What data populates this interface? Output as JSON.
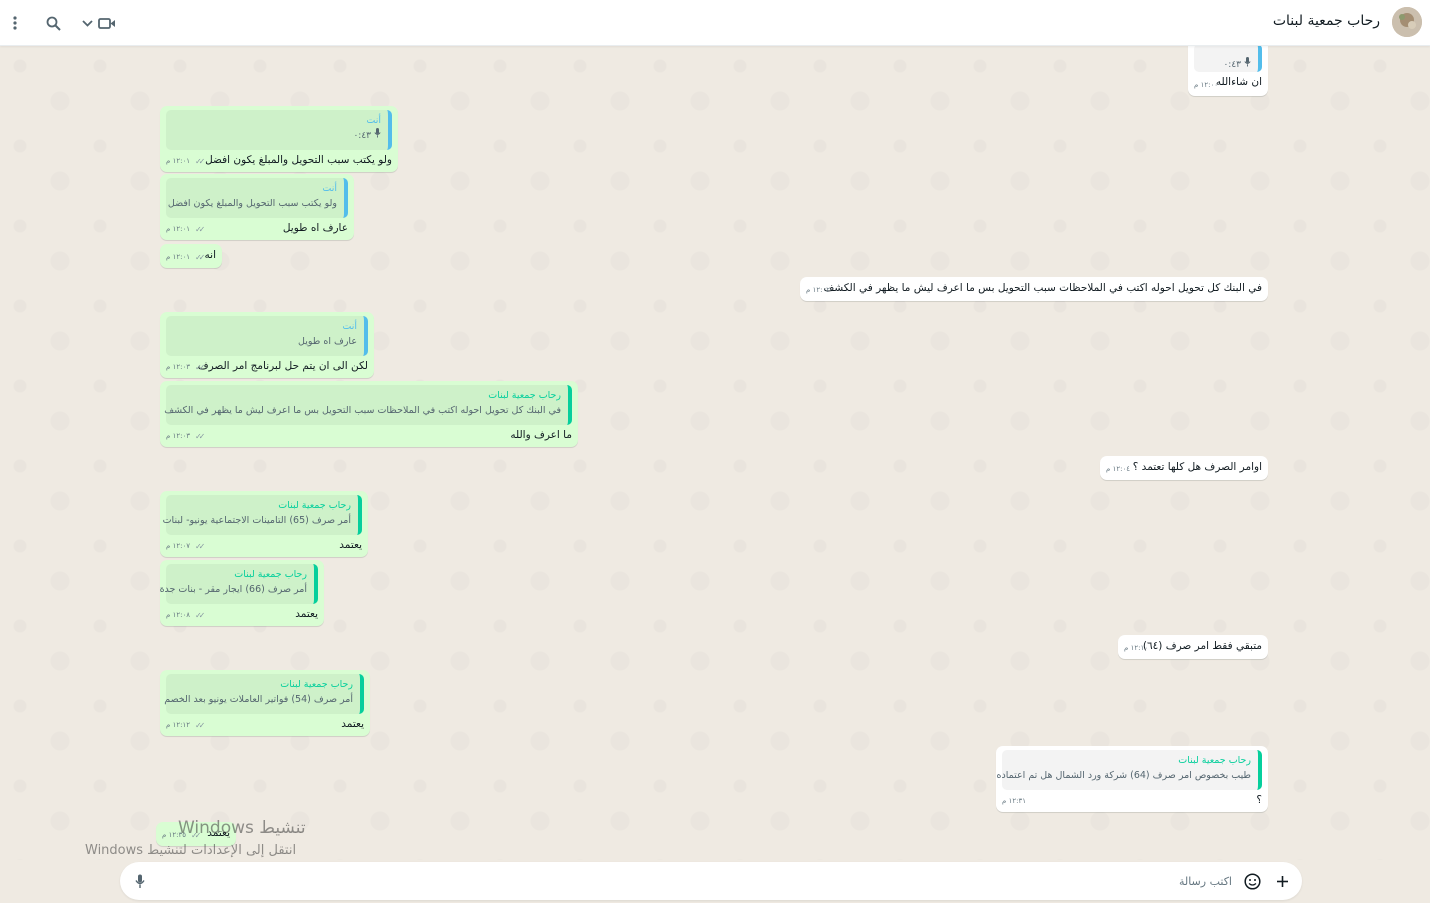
{
  "header": {
    "contact_name": "رحاب جمعية لبنات",
    "icons": [
      "menu-icon",
      "search-icon",
      "chevron-down-icon",
      "video-call-icon",
      "avatar"
    ]
  },
  "messages": {
    "m0": {
      "voice_duration": "٠:٤٣",
      "text": "ان شاءالله",
      "time": "١٢:٠٠ م"
    },
    "m1": {
      "quote_name": "أنت",
      "voice_duration": "٠:٤٣",
      "text": "ولو يكتب سبب التحويل والمبلغ يكون افضل",
      "time": "١٢:٠١ م"
    },
    "m2": {
      "quote_name": "أنت",
      "quote_text": "ولو يكتب سبب التحويل والمبلغ يكون افضل",
      "text": "عارف اه طويل",
      "time": "١٢:٠١ م"
    },
    "m3": {
      "text": "انه",
      "time": "١٢:٠١ م"
    },
    "m4": {
      "text": "في البنك كل تحويل احوله اكتب في الملاحظات سبب التحويل بس ما اعرف ليش ما يظهر في الكشف",
      "time": "١٢:٠٢ م"
    },
    "m5": {
      "quote_name": "أنت",
      "quote_text": "عارف اه طويل",
      "text": "لكن الى ان يتم حل لبرنامج امر الصرف",
      "time": "١٢:٠٣ م"
    },
    "m6": {
      "quote_name": "رحاب جمعية لبنات",
      "quote_text": "في البنك كل تحويل احوله اكتب في الملاحظات سبب التحويل بس ما اعرف ليش ما يظهر في الكشف",
      "text": "ما اعرف والله",
      "time": "١٢:٠٣ م"
    },
    "m7": {
      "text": "اوامر الصرف هل كلها تعتمد ؟",
      "time": "١٢:٠٤ م"
    },
    "m8": {
      "quote_name": "رحاب جمعية لبنات",
      "quote_text": "أمر صرف (65) التامينات الاجتماعية يونيو- لبنات",
      "text": "يعتمد",
      "time": "١٢:٠٧ م"
    },
    "m9": {
      "quote_name": "رحاب جمعية لبنات",
      "quote_text": "أمر صرف (66) ايجار مقر  - بنات جدة",
      "text": "يعتمد",
      "time": "١٢:٠٨ م"
    },
    "m10": {
      "text": "متبقي فقط امر صرف (٦٤)",
      "time": "١٢:١٠ م"
    },
    "m11": {
      "quote_name": "رحاب جمعية لبنات",
      "quote_text": "أمر صرف (54) فواتير العاملات يونيو بعد الخصم",
      "text": "يعتمد",
      "time": "١٢:١٢ م"
    },
    "m12": {
      "quote_name": "رحاب جمعية لبنات",
      "quote_text": "طيب بخصوص امر صرف (64) شركة ورد الشمال هل تم اعتماده",
      "text": "؟",
      "time": "١٢:٣١ م"
    },
    "m13": {
      "text": "يعتمد",
      "time": "١٢:٣٥ م"
    }
  },
  "composer": {
    "placeholder": "اكتب رسالة"
  },
  "watermark": {
    "line1": "تنشيط Windows",
    "line2": "انتقل إلى الإعدادات لتنشيط Windows"
  },
  "colors": {
    "outgoing": "#d9fdd3",
    "incoming": "#ffffff",
    "quote_self": "#53bdeb",
    "quote_other": "#06cf9c",
    "background": "#efeae2"
  }
}
